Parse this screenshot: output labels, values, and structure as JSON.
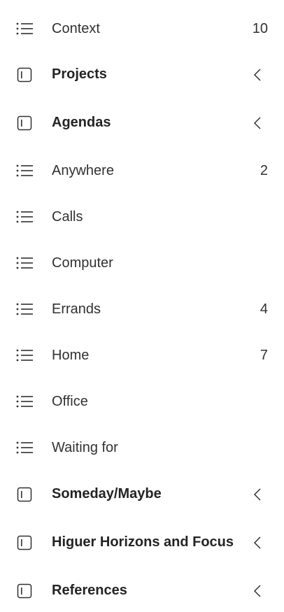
{
  "nav": {
    "items": [
      {
        "type": "list",
        "label": "Context",
        "count": "10",
        "icon": "list-icon"
      },
      {
        "type": "group",
        "label": "Projects",
        "count": "",
        "icon": "folder-icon",
        "expandable": true
      },
      {
        "type": "group",
        "label": "Agendas",
        "count": "",
        "icon": "folder-icon",
        "expandable": true
      },
      {
        "type": "list",
        "label": "Anywhere",
        "count": "2",
        "icon": "list-icon"
      },
      {
        "type": "list",
        "label": "Calls",
        "count": "",
        "icon": "list-icon"
      },
      {
        "type": "list",
        "label": "Computer",
        "count": "",
        "icon": "list-icon"
      },
      {
        "type": "list",
        "label": "Errands",
        "count": "4",
        "icon": "list-icon"
      },
      {
        "type": "list",
        "label": "Home",
        "count": "7",
        "icon": "list-icon"
      },
      {
        "type": "list",
        "label": "Office",
        "count": "",
        "icon": "list-icon"
      },
      {
        "type": "list",
        "label": "Waiting for",
        "count": "",
        "icon": "list-icon"
      },
      {
        "type": "group",
        "label": "Someday/Maybe",
        "count": "",
        "icon": "folder-icon",
        "expandable": true
      },
      {
        "type": "group",
        "label": "Higuer Horizons and Focus",
        "count": "",
        "icon": "folder-icon",
        "expandable": true
      },
      {
        "type": "group",
        "label": "References",
        "count": "",
        "icon": "folder-icon",
        "expandable": true
      }
    ]
  },
  "colors": {
    "text": "#323130",
    "icon": "#323130",
    "background": "#ffffff"
  }
}
